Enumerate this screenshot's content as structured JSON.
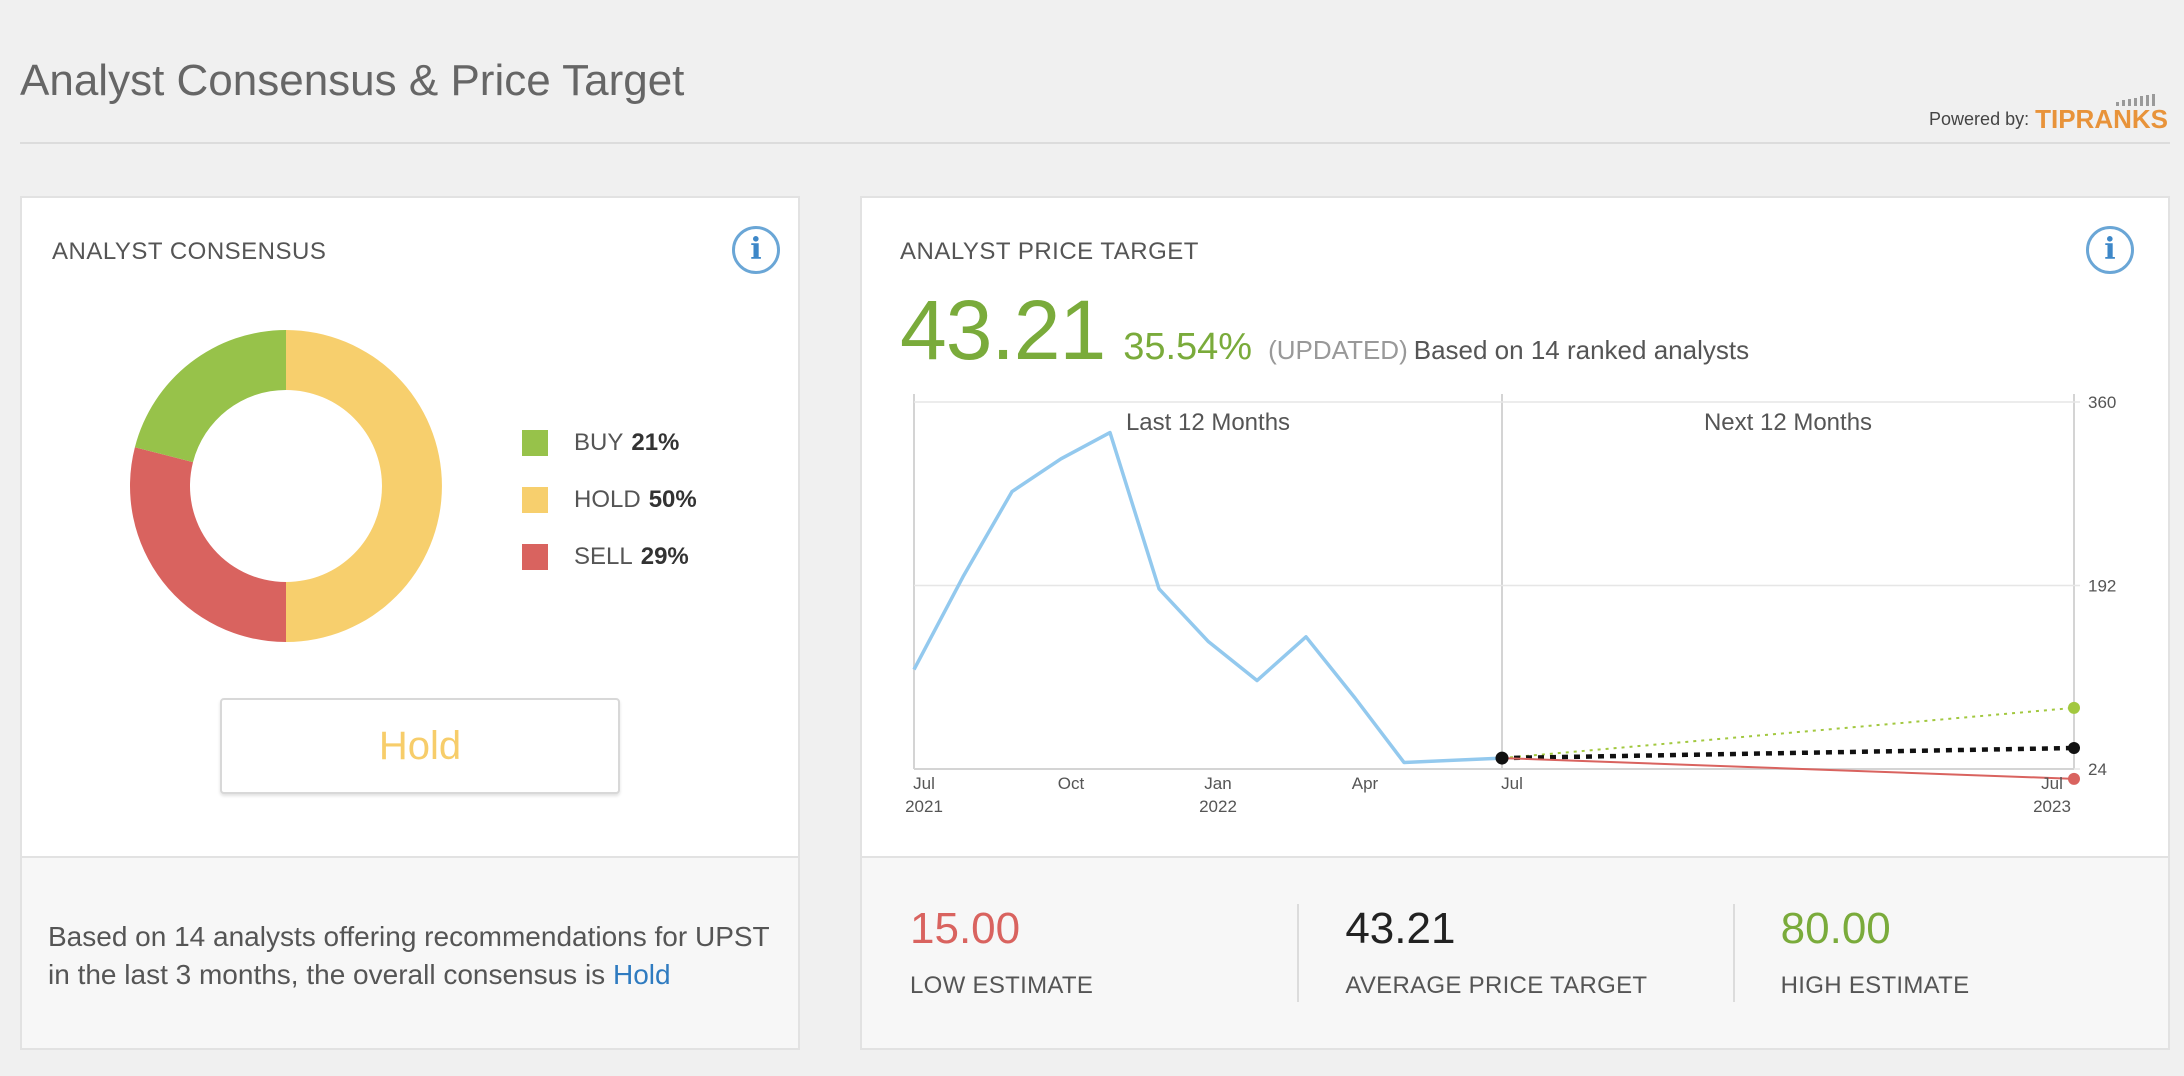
{
  "page": {
    "title": "Analyst Consensus & Price Target",
    "powered_by_label": "Powered by:",
    "powered_by_brand": "TIPRANKS"
  },
  "consensus": {
    "label": "ANALYST CONSENSUS",
    "info_icon": "i",
    "legend": [
      {
        "name": "BUY",
        "percent": "21%",
        "value": 21,
        "color": "#97c24a"
      },
      {
        "name": "HOLD",
        "percent": "50%",
        "value": 50,
        "color": "#f7cf6d"
      },
      {
        "name": "SELL",
        "percent": "29%",
        "value": 29,
        "color": "#d9635f"
      }
    ],
    "rating": "Hold",
    "summary_prefix": "Based on 14 analysts offering recommendations for UPST in the last 3 months, the overall consensus is ",
    "summary_link": "Hold"
  },
  "price_target": {
    "label": "ANALYST PRICE TARGET",
    "info_icon": "i",
    "value": "43.21",
    "change": "35.54%",
    "updated": "(UPDATED)",
    "based_on": "Based on 14 ranked analysts",
    "low_value": "15.00",
    "low_label": "LOW ESTIMATE",
    "avg_value": "43.21",
    "avg_label": "AVERAGE PRICE TARGET",
    "high_value": "80.00",
    "high_label": "HIGH ESTIMATE"
  },
  "chart_data": {
    "type": "line",
    "period_labels": [
      "Last 12 Months",
      "Next 12 Months"
    ],
    "y_ticks": [
      360,
      192,
      24
    ],
    "ylim": [
      24,
      360
    ],
    "x_ticks": [
      {
        "month": "Jul",
        "year": "2021",
        "t": 0
      },
      {
        "month": "Oct",
        "year": "",
        "t": 3
      },
      {
        "month": "Jan",
        "year": "2022",
        "t": 6
      },
      {
        "month": "Apr",
        "year": "",
        "t": 9
      },
      {
        "month": "Jul",
        "year": "",
        "t": 12
      },
      {
        "month": "Jul",
        "year": "2023",
        "t": 24
      }
    ],
    "series": [
      {
        "name": "",
        "color": "#93c9ee",
        "points": [
          [
            0,
            115
          ],
          [
            1,
            200
          ],
          [
            2,
            278
          ],
          [
            3,
            308
          ],
          [
            4,
            332
          ],
          [
            5,
            189
          ],
          [
            6,
            141
          ],
          [
            7,
            105
          ],
          [
            8,
            145
          ],
          [
            9,
            89
          ],
          [
            10,
            30
          ],
          [
            12,
            34
          ]
        ]
      }
    ],
    "projections": [
      {
        "name": "high",
        "value": 80.0,
        "color": "#a2c83f"
      },
      {
        "name": "average",
        "value": 43.21,
        "color": "#111111"
      },
      {
        "name": "low",
        "value": 15.0,
        "color": "#d9635f"
      }
    ],
    "projection_start": [
      12,
      34
    ],
    "grid": true
  }
}
